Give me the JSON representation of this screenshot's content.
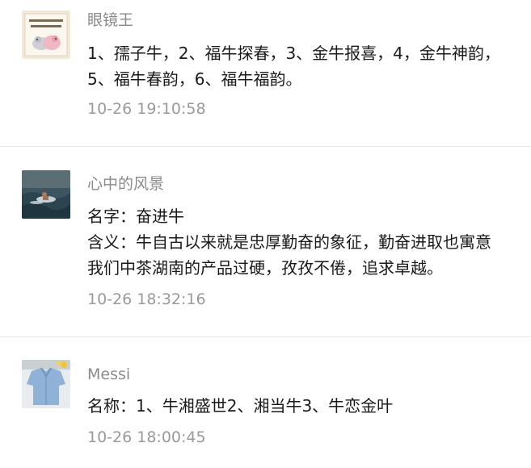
{
  "comments": [
    {
      "author": "眼镜王",
      "avatar_icon": "sheep-cartoon-avatar-icon",
      "lines": [
        "1、孺子牛，2、福牛探春，3、金牛报喜，4，金牛神韵，",
        "5、福牛春韵，6、福牛福韵。"
      ],
      "time": "10-26 19:10:58"
    },
    {
      "author": "心中的风景",
      "avatar_icon": "sea-swimmer-photo-avatar-icon",
      "lines": [
        "名字：奋进牛",
        "含义：牛自古以来就是忠厚勤奋的象征，勤奋进取也寓意",
        "我们中茶湖南的产品过硬，孜孜不倦，追求卓越。"
      ],
      "time": "10-26 18:32:16"
    },
    {
      "author": "Messi",
      "avatar_icon": "blue-shirt-photo-avatar-icon",
      "lines": [
        "名称：1、牛湘盛世2、湘当牛3、牛恋金叶"
      ],
      "time": "10-26 18:00:45"
    }
  ],
  "colors": {
    "author": "#8a8a8a",
    "body": "#1a1a1a",
    "time": "#9a9a9a",
    "divider": "#e6e6e6"
  }
}
